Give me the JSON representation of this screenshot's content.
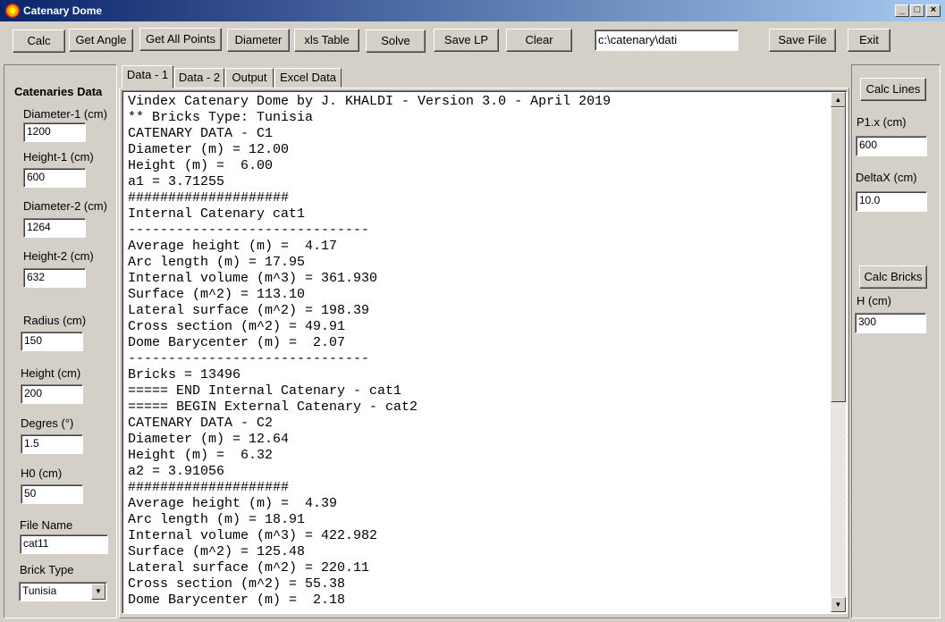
{
  "window": {
    "title": "Catenary Dome"
  },
  "toolbar": {
    "calc": "Calc",
    "get_angle": "Get Angle",
    "get_all_points": "Get All Points",
    "diameter": "Diameter",
    "xls_table": "xls Table",
    "solve": "Solve",
    "save_lp": "Save LP",
    "clear": "Clear",
    "path_value": "c:\\catenary\\dati",
    "save_file": "Save File",
    "exit": "Exit"
  },
  "left_panel": {
    "heading": "Catenaries Data",
    "diameter1_label": "Diameter-1 (cm)",
    "diameter1_value": "1200",
    "height1_label": "Height-1 (cm)",
    "height1_value": "600",
    "diameter2_label": "Diameter-2 (cm)",
    "diameter2_value": "1264",
    "height2_label": "Height-2 (cm)",
    "height2_value": "632",
    "radius_label": "Radius (cm)",
    "radius_value": "150",
    "height_label": "Height (cm)",
    "height_value": "200",
    "degrees_label": "Degres (°)",
    "degrees_value": "1.5",
    "h0_label": "H0 (cm)",
    "h0_value": "50",
    "filename_label": "File Name",
    "filename_value": "cat11",
    "bricktype_label": "Brick Type",
    "bricktype_value": "Tunisia"
  },
  "tabs": [
    "Data - 1",
    "Data - 2",
    "Output",
    "Excel Data"
  ],
  "output_text": "Vindex Catenary Dome by J. KHALDI - Version 3.0 - April 2019\n** Bricks Type: Tunisia\nCATENARY DATA - C1\nDiameter (m) = 12.00\nHeight (m) =  6.00\na1 = 3.71255\n####################\nInternal Catenary cat1\n------------------------------\nAverage height (m) =  4.17\nArc length (m) = 17.95\nInternal volume (m^3) = 361.930\nSurface (m^2) = 113.10\nLateral surface (m^2) = 198.39\nCross section (m^2) = 49.91\nDome Barycenter (m) =  2.07\n------------------------------\nBricks = 13496\n===== END Internal Catenary - cat1\n===== BEGIN External Catenary - cat2\nCATENARY DATA - C2\nDiameter (m) = 12.64\nHeight (m) =  6.32\na2 = 3.91056\n####################\nAverage height (m) =  4.39\nArc length (m) = 18.91\nInternal volume (m^3) = 422.982\nSurface (m^2) = 125.48\nLateral surface (m^2) = 220.11\nCross section (m^2) = 55.38\nDome Barycenter (m) =  2.18",
  "right_panel": {
    "calc_lines": "Calc Lines",
    "p1x_label": "P1.x (cm)",
    "p1x_value": "600",
    "deltax_label": "DeltaX (cm)",
    "deltax_value": "10.0",
    "calc_bricks": "Calc Bricks",
    "h_label": "H (cm)",
    "h_value": "300"
  }
}
